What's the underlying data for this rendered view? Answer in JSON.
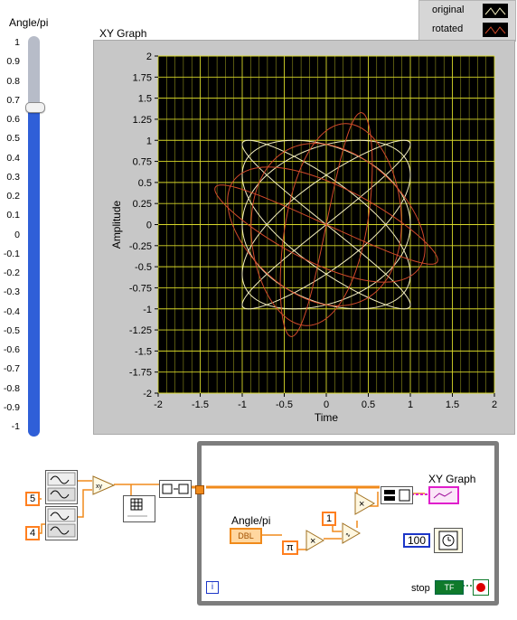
{
  "slider": {
    "title": "Angle/pi",
    "value": 0.65,
    "min": -1,
    "max": 1,
    "ticks": [
      "1",
      "0.9",
      "0.8",
      "0.7",
      "0.6",
      "0.5",
      "0.4",
      "0.3",
      "0.2",
      "0.1",
      "0",
      "-0.1",
      "-0.2",
      "-0.3",
      "-0.4",
      "-0.5",
      "-0.6",
      "-0.7",
      "-0.8",
      "-0.9",
      "-1"
    ],
    "fill_color": "#2f5fd8"
  },
  "graph": {
    "title": "XY Graph",
    "xlabel": "Time",
    "ylabel": "Amplitude",
    "x_ticks": [
      "-2",
      "-1.5",
      "-1",
      "-0.5",
      "0",
      "0.5",
      "1",
      "1.5",
      "2"
    ],
    "y_ticks": [
      "2",
      "1.75",
      "1.5",
      "1.25",
      "1",
      "0.75",
      "0.5",
      "0.25",
      "0",
      "-0.25",
      "-0.5",
      "-0.75",
      "-1",
      "-1.25",
      "-1.5",
      "-1.75",
      "-2"
    ],
    "legend": [
      {
        "label": "original",
        "color": "#f5f0c0"
      },
      {
        "label": "rotated",
        "color": "#d24a2a"
      }
    ],
    "plot_bg": "#000000",
    "grid_color": "#d8d82a"
  },
  "chart_data": {
    "type": "line",
    "title": "XY Graph",
    "xlabel": "Time",
    "ylabel": "Amplitude",
    "xlim": [
      -2,
      2
    ],
    "ylim": [
      -2,
      2
    ],
    "grid": true,
    "legend_position": "top-right",
    "series": [
      {
        "name": "original",
        "kind": "lissajous",
        "fx": 5,
        "fy": 4,
        "amplitude": 1,
        "color": "#f5f0c0"
      },
      {
        "name": "rotated",
        "kind": "lissajous-rotated",
        "fx": 5,
        "fy": 4,
        "amplitude": 1,
        "rotation_pi": 0.65,
        "color": "#d24a2a"
      }
    ]
  },
  "diagram": {
    "const_5": "5",
    "const_4": "4",
    "const_1": "1",
    "const_100": "100",
    "pi_symbol": "π",
    "angle_label": "Angle/pi",
    "angle_terminal": "DBL",
    "xy_label": "XY Graph",
    "iter_label": "i",
    "stop_label": "stop",
    "stop_terminal": "TF",
    "multiply": "×",
    "wire_color": "#f08a1b"
  }
}
